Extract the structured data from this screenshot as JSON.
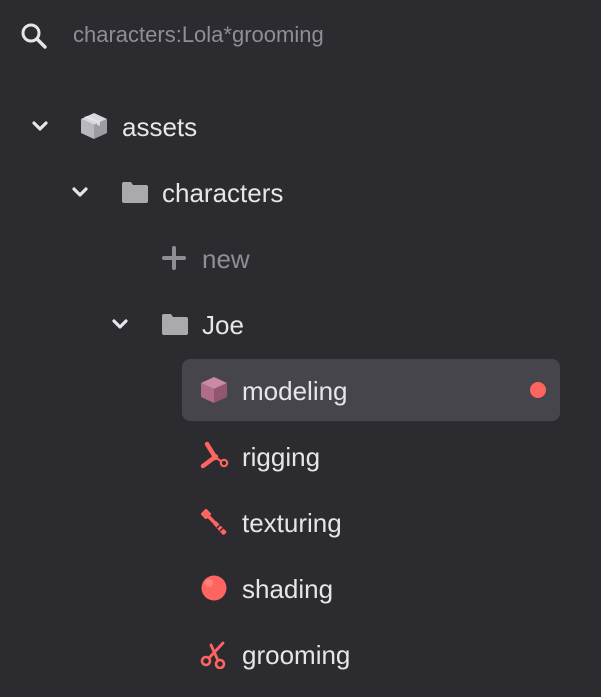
{
  "search": {
    "icon": "search-icon",
    "query": "characters:Lola*grooming"
  },
  "tree": {
    "assets": {
      "label": "assets",
      "icon": "package-icon",
      "expanded": true
    },
    "characters": {
      "label": "characters",
      "icon": "folder-icon",
      "expanded": true
    },
    "new": {
      "label": "new",
      "icon": "plus-icon"
    },
    "joe": {
      "label": "Joe",
      "icon": "folder-icon",
      "expanded": true
    },
    "tasks": [
      {
        "label": "modeling",
        "icon": "cube-icon",
        "selected": true,
        "status": "active"
      },
      {
        "label": "rigging",
        "icon": "rig-icon"
      },
      {
        "label": "texturing",
        "icon": "brush-icon"
      },
      {
        "label": "shading",
        "icon": "sphere-icon"
      },
      {
        "label": "grooming",
        "icon": "scissors-icon"
      }
    ]
  },
  "colors": {
    "background": "#2b2b30",
    "selected_row": "#45454b",
    "accent": "#ff6461",
    "text": "#e6e6ea",
    "muted_text": "#8e8e96",
    "folder_icon": "#a9a9ae",
    "cube_icon": "#b46a86"
  }
}
